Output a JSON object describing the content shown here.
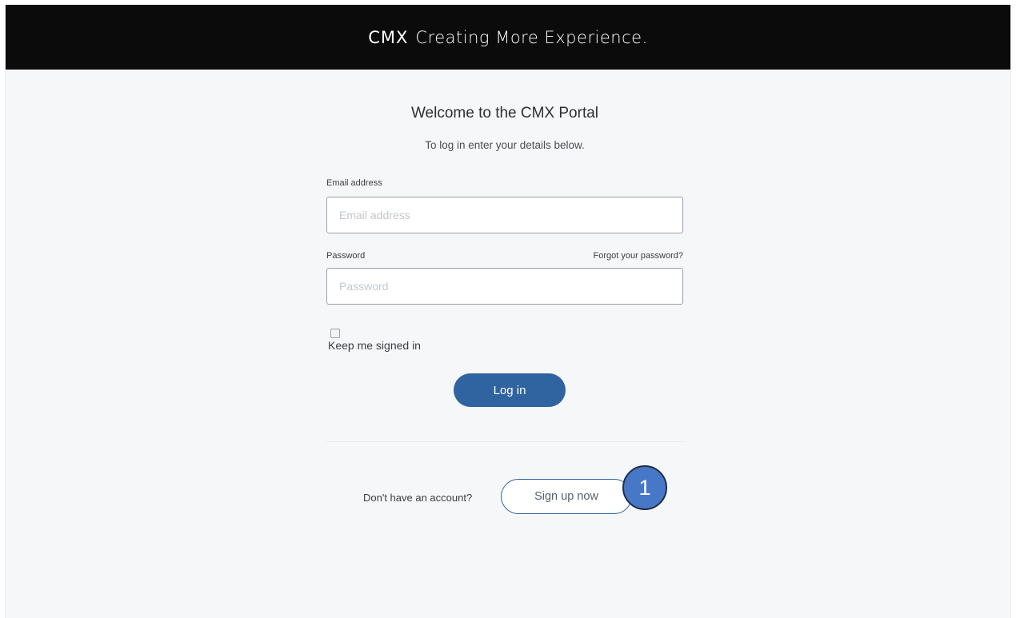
{
  "header": {
    "logo": "CMX",
    "tagline": "Creating More Experience."
  },
  "login": {
    "title": "Welcome to the CMX Portal",
    "subtitle": "To log in enter your details below.",
    "email_label": "Email address",
    "email_placeholder": "Email address",
    "password_label": "Password",
    "password_placeholder": "Password",
    "forgot_link": "Forgot your password?",
    "keep_signed_in": "Keep me signed in",
    "keep_signed_in_checked": false,
    "login_button": "Log in"
  },
  "signup": {
    "prompt": "Don't have an account?",
    "button": "Sign up now"
  },
  "annotation": {
    "step_number": "1"
  },
  "colors": {
    "header_bg": "#0b0b0b",
    "page_bg": "#f6f7f9",
    "primary": "#2f64a0",
    "badge": "#4778c8"
  }
}
